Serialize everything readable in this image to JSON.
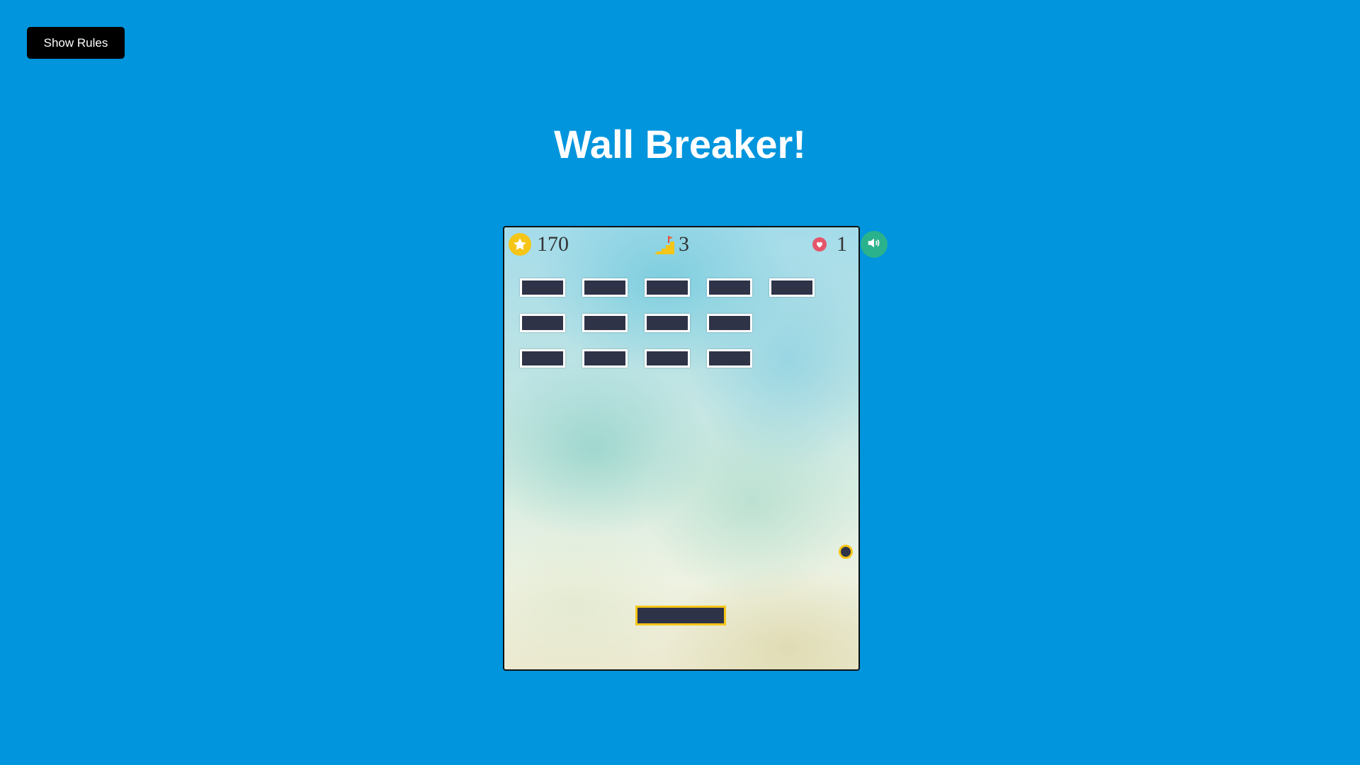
{
  "header": {
    "rules_button_label": "Show Rules",
    "title": "Wall Breaker!"
  },
  "hud": {
    "score": "170",
    "level": "3",
    "lives": "1",
    "score_icon": "star-icon",
    "level_icon": "level-flag-icon",
    "lives_icon": "heart-icon",
    "sound_icon": "speaker-icon"
  },
  "colors": {
    "background": "#0095dd",
    "brick": "#2f3348",
    "brick_border": "#ffffff",
    "paddle_border": "#f5c518",
    "sound_button": "#2ab28c",
    "heart": "#e4566a",
    "star": "#f5c518"
  },
  "bricks": {
    "rows": [
      [
        true,
        true,
        true,
        true,
        true
      ],
      [
        true,
        true,
        true,
        true,
        false
      ],
      [
        true,
        true,
        true,
        true,
        false
      ]
    ]
  }
}
